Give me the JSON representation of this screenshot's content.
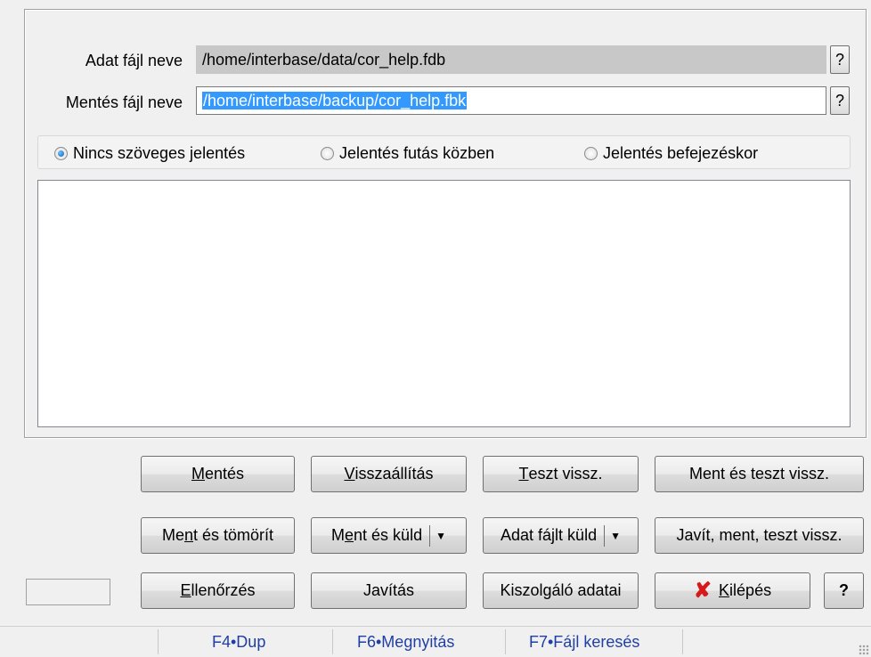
{
  "form": {
    "data_file_label": "Adat fájl neve",
    "data_file_value": "/home/interbase/data/cor_help.fdb",
    "backup_file_label": "Mentés fájl neve",
    "backup_file_value": "/home/interbase/backup/cor_help.fbk",
    "help_button": "?"
  },
  "report_options": {
    "options": [
      {
        "label": "Nincs szöveges jelentés",
        "selected": true
      },
      {
        "label": "Jelentés futás közben",
        "selected": false
      },
      {
        "label": "Jelentés befejezéskor",
        "selected": false
      }
    ]
  },
  "buttons": {
    "row1": {
      "save": {
        "pre": "",
        "u": "M",
        "post": "entés"
      },
      "restore": {
        "pre": "",
        "u": "V",
        "post": "isszaállítás"
      },
      "test_restore": {
        "pre": "",
        "u": "T",
        "post": "eszt vissz."
      },
      "save_test_restore": "Ment és teszt vissz."
    },
    "row2": {
      "save_compress": {
        "pre": "Me",
        "u": "n",
        "post": "t és tömörít"
      },
      "save_send": {
        "pre": "M",
        "u": "e",
        "post": "nt és küld"
      },
      "send_data_file": "Adat fájlt küld",
      "fix_save_test": "Javít, ment, teszt vissz."
    },
    "row3": {
      "check": {
        "pre": "",
        "u": "E",
        "post": "llenőrzés"
      },
      "fix": "Javítás",
      "server_data": "Kiszolgáló adatai",
      "exit": {
        "pre": "",
        "u": "K",
        "post": "ilépés"
      },
      "help": "?"
    },
    "dropdown_arrow": "▼"
  },
  "statusbar": {
    "f4": "F4•Dup",
    "f6": "F6•Megnyitás",
    "f7": "F7•Fájl keresés"
  },
  "colors": {
    "selection": "#3399ff",
    "status_text": "#1f3fa6",
    "exit_icon": "#d61a1a"
  }
}
